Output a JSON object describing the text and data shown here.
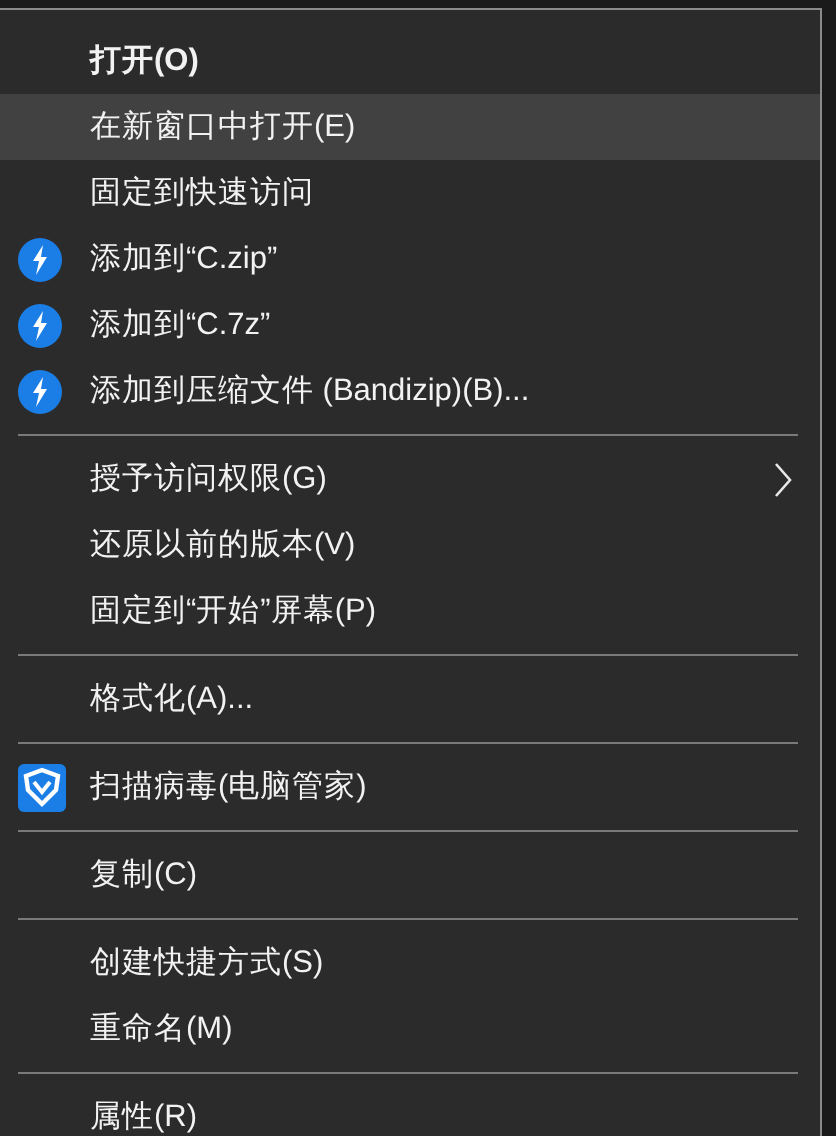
{
  "menu": {
    "items": [
      {
        "kind": "item",
        "label": "打开(O)",
        "default": true,
        "selected": false,
        "has_submenu": false
      },
      {
        "kind": "item",
        "label": "在新窗口中打开(E)",
        "default": false,
        "selected": true,
        "has_submenu": false
      },
      {
        "kind": "item",
        "label": "固定到快速访问",
        "default": false,
        "selected": false,
        "has_submenu": false
      },
      {
        "kind": "archiver_item",
        "label": "添加到“C.zip”",
        "default": false,
        "selected": false,
        "has_submenu": false
      },
      {
        "kind": "archiver_item",
        "label": "添加到“C.7z”",
        "default": false,
        "selected": false,
        "has_submenu": false
      },
      {
        "kind": "archiver_item",
        "label": "添加到压缩文件 (Bandizip)(B)...",
        "default": false,
        "selected": false,
        "has_submenu": false
      },
      {
        "kind": "separator"
      },
      {
        "kind": "item",
        "label": "授予访问权限(G)",
        "default": false,
        "selected": false,
        "has_submenu": true
      },
      {
        "kind": "item",
        "label": "还原以前的版本(V)",
        "default": false,
        "selected": false,
        "has_submenu": false
      },
      {
        "kind": "item",
        "label": "固定到“开始”屏幕(P)",
        "default": false,
        "selected": false,
        "has_submenu": false
      },
      {
        "kind": "separator"
      },
      {
        "kind": "item",
        "label": "格式化(A)...",
        "default": false,
        "selected": false,
        "has_submenu": false
      },
      {
        "kind": "separator"
      },
      {
        "kind": "antivirus_item",
        "label": "扫描病毒(电脑管家)",
        "default": false,
        "selected": false,
        "has_submenu": false
      },
      {
        "kind": "separator"
      },
      {
        "kind": "item",
        "label": "复制(C)",
        "default": false,
        "selected": false,
        "has_submenu": false
      },
      {
        "kind": "separator"
      },
      {
        "kind": "item",
        "label": "创建快捷方式(S)",
        "default": false,
        "selected": false,
        "has_submenu": false
      },
      {
        "kind": "item",
        "label": "重命名(M)",
        "default": false,
        "selected": false,
        "has_submenu": false
      },
      {
        "kind": "separator"
      },
      {
        "kind": "item",
        "label": "属性(R)",
        "default": false,
        "selected": false,
        "has_submenu": false
      }
    ]
  }
}
